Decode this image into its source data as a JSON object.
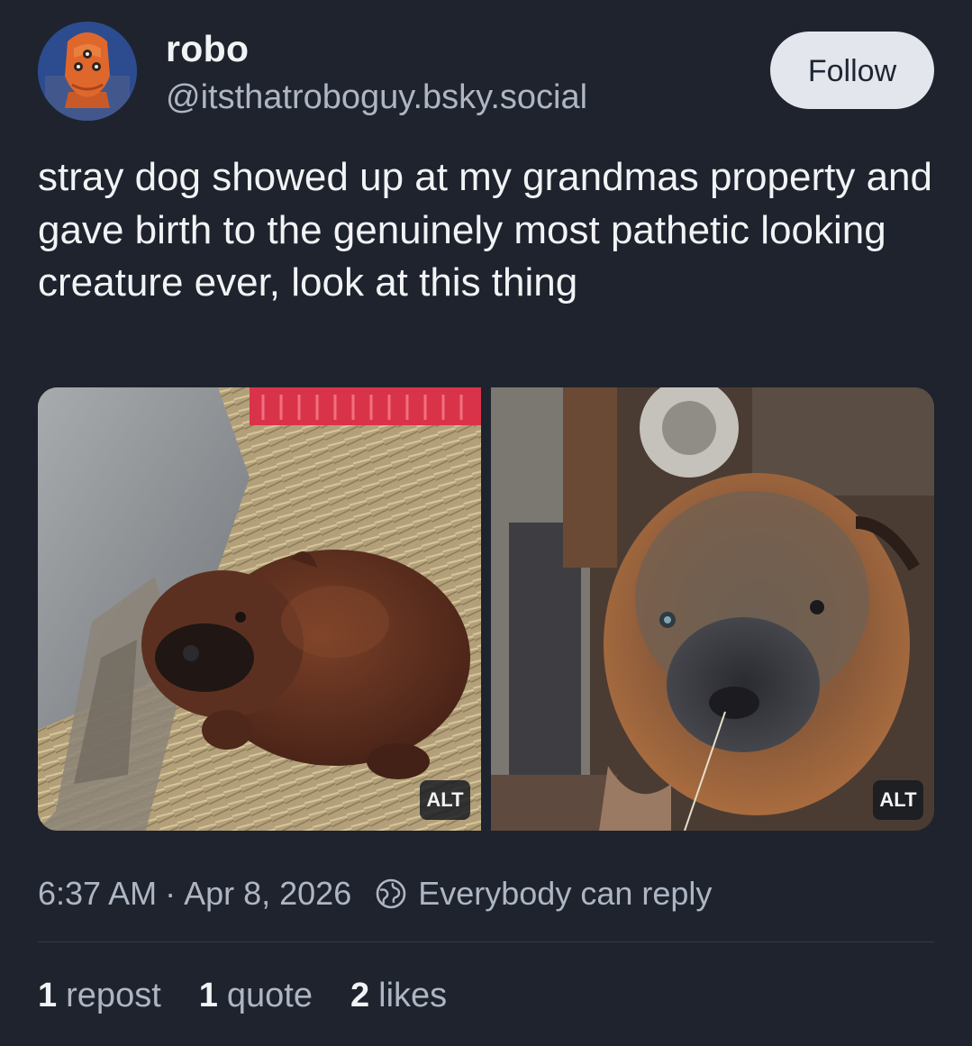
{
  "author": {
    "display_name": "robo",
    "handle": "@itsthatroboguy.bsky.social",
    "avatar_icon": "robot-mask-avatar"
  },
  "follow_label": "Follow",
  "post": {
    "text": "stray dog showed up at my grandmas property and gave birth to the genuinely most pathetic looking creature ever, look at this thing",
    "images": [
      {
        "alt_label": "ALT",
        "subject": "puppy-in-hay"
      },
      {
        "alt_label": "ALT",
        "subject": "puppy-closeup"
      }
    ]
  },
  "meta": {
    "time": "6:37 AM",
    "separator": "·",
    "date": "Apr 8, 2026",
    "reply_setting": "Everybody can reply",
    "reply_icon": "globe-reply-icon"
  },
  "stats": {
    "reposts_count": "1",
    "reposts_label": "repost",
    "quotes_count": "1",
    "quotes_label": "quote",
    "likes_count": "2",
    "likes_label": "likes"
  },
  "colors": {
    "background": "#1e232d",
    "text_primary": "#f1f3f5",
    "text_secondary": "#aeb6c4",
    "follow_button_bg": "#e3e7ed"
  }
}
